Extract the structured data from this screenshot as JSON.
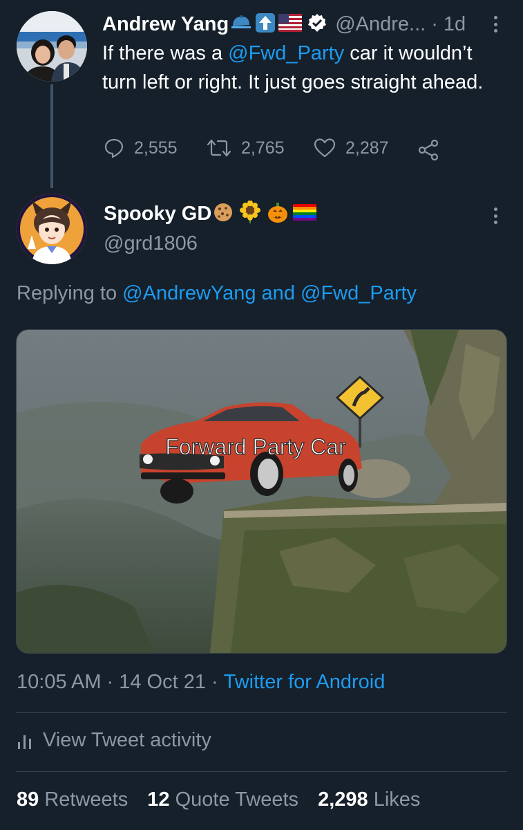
{
  "parent_tweet": {
    "author_name": "Andrew Yang",
    "author_handle": "@Andre...",
    "separator": "·",
    "age": "1d",
    "text_pre": "If there was a ",
    "mention": "@Fwd_Party",
    "text_post": " car it wouldn’t turn left or right. It just goes straight ahead.",
    "actions": {
      "replies": "2,555",
      "retweets": "2,765",
      "likes": "2,287"
    },
    "icons": [
      "cap-emoji-icon",
      "up-arrow-emoji-icon",
      "us-flag-emoji-icon",
      "verified-badge-icon",
      "more-icon",
      "reply-icon",
      "retweet-icon",
      "like-icon",
      "share-icon"
    ]
  },
  "reply_tweet": {
    "author_name": "Spooky GD",
    "author_handle": "@grd1806",
    "icons": [
      "cookie-emoji-icon",
      "sunflower-emoji-icon",
      "pumpkin-emoji-icon",
      "rainbow-flag-emoji-icon",
      "more-icon"
    ],
    "replying_prefix": "Replying to ",
    "replying_to_1": "@AndrewYang",
    "replying_and": " and ",
    "replying_to_2": "@Fwd_Party",
    "media": {
      "caption": "Forward Party Car"
    },
    "time": "10:05 AM",
    "date": "14 Oct 21",
    "source": "Twitter for Android",
    "dot": "·",
    "view_activity": "View Tweet activity",
    "stats": {
      "retweets_count": "89",
      "retweets_label": "Retweets",
      "quotes_count": "12",
      "quotes_label": "Quote Tweets",
      "likes_count": "2,298",
      "likes_label": "Likes"
    }
  },
  "colors": {
    "background": "#15202b",
    "accent": "#1d9bf0",
    "secondary_text": "#8b98a5",
    "divider": "#38444d"
  }
}
